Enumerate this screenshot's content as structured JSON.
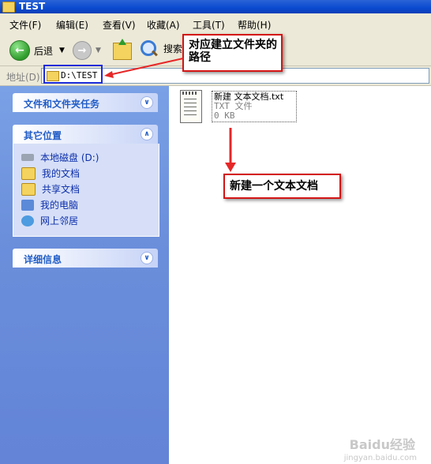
{
  "window": {
    "title": "TEST"
  },
  "menubar": {
    "items": [
      "文件(F)",
      "编辑(E)",
      "查看(V)",
      "收藏(A)",
      "工具(T)",
      "帮助(H)"
    ]
  },
  "toolbar": {
    "back_label": "后退",
    "search_label": "搜索"
  },
  "address": {
    "label": "地址(D)",
    "path": "D:\\TEST"
  },
  "sidebar": {
    "task_panel": {
      "title": "文件和文件夹任务"
    },
    "other_places": {
      "title": "其它位置",
      "items": [
        {
          "label": "本地磁盘 (D:)",
          "icon": "drive-icon",
          "color": "#9aa4b2"
        },
        {
          "label": "我的文档",
          "icon": "my-documents-icon",
          "color": "#f4d35e"
        },
        {
          "label": "共享文档",
          "icon": "shared-folder-icon",
          "color": "#f4d35e"
        },
        {
          "label": "我的电脑",
          "icon": "my-computer-icon",
          "color": "#5b8ad9"
        },
        {
          "label": "网上邻居",
          "icon": "network-icon",
          "color": "#4d9be0"
        }
      ]
    },
    "details_panel": {
      "title": "详细信息"
    }
  },
  "file": {
    "name": "新建 文本文档.txt",
    "type": "TXT 文件",
    "size": "0 KB"
  },
  "annotations": {
    "path_callout": "对应建立文件夹的路径",
    "file_callout": "新建一个文本文档"
  },
  "watermark": {
    "text": "Baidu经验",
    "url": "jingyan.baidu.com"
  }
}
